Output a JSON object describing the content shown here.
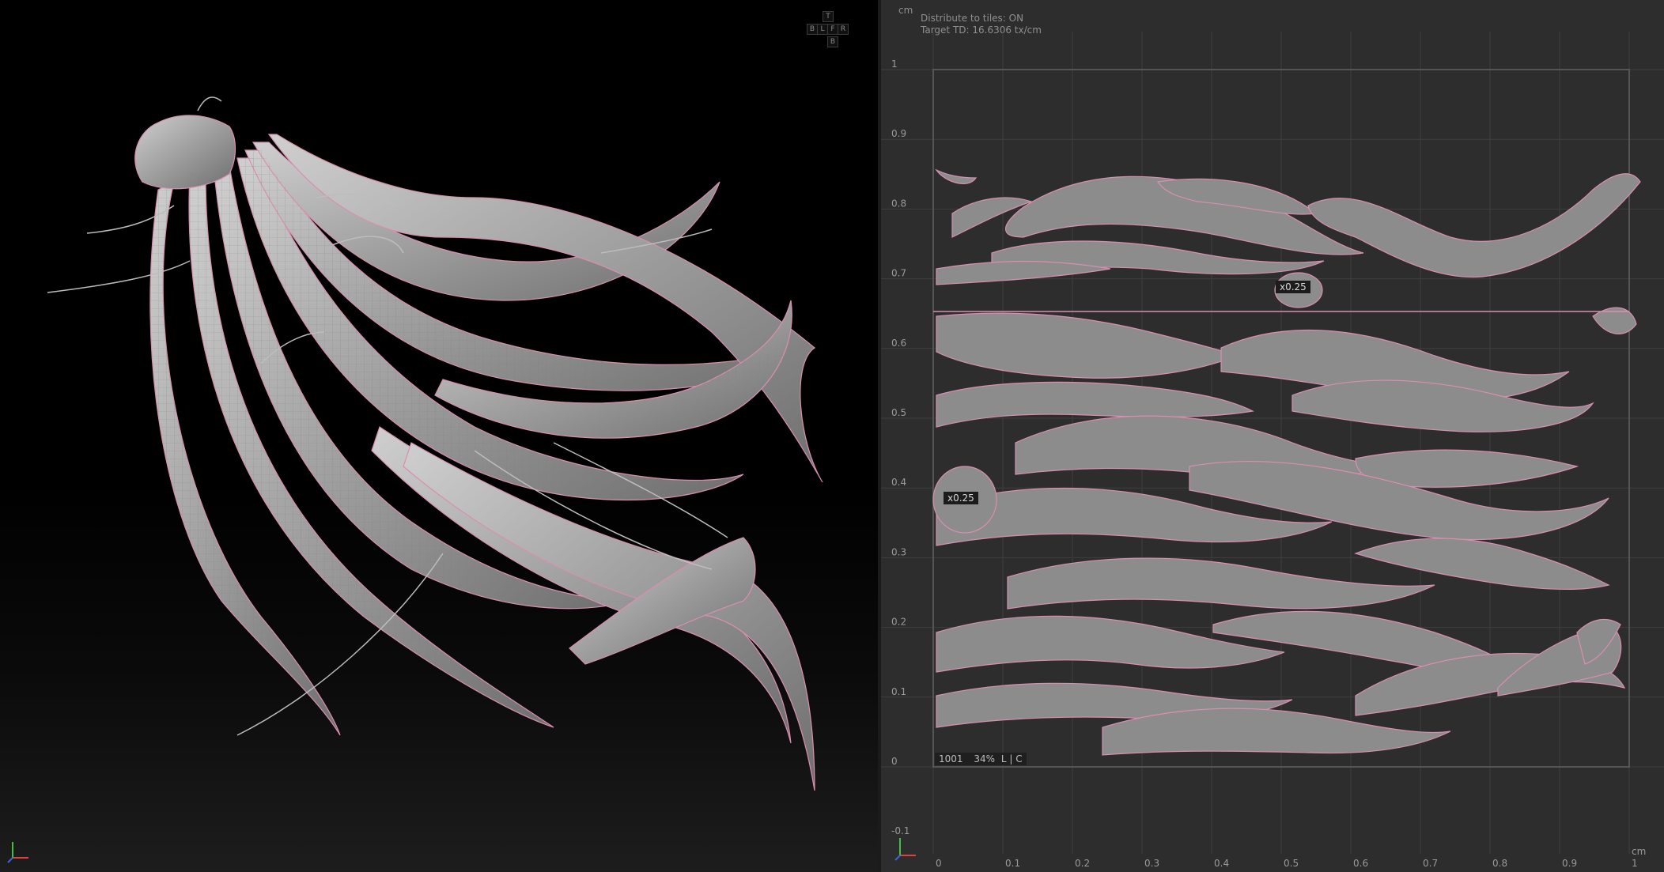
{
  "navcube": {
    "top": "T",
    "back": "B",
    "left": "L",
    "front": "F",
    "right": "R",
    "bottom": "B"
  },
  "uv_info": {
    "unit": "cm",
    "distribute": "Distribute to tiles: ON",
    "target_td": "Target TD: 16.6306 tx/cm"
  },
  "uv_axis": {
    "x_ticks": [
      "0",
      "0.1",
      "0.2",
      "0.3",
      "0.4",
      "0.5",
      "0.6",
      "0.7",
      "0.8",
      "0.9",
      "1"
    ],
    "y_ticks": [
      "1",
      "0.9",
      "0.8",
      "0.7",
      "0.6",
      "0.5",
      "0.4",
      "0.3",
      "0.2",
      "0.1",
      "0",
      "-0.1"
    ],
    "x_unit": "cm"
  },
  "tile_label": {
    "tile": "1001",
    "coverage": "34%",
    "flags": "L | C"
  },
  "badges": {
    "scale_a": "x0.25",
    "scale_b": "x0.25"
  },
  "colors": {
    "mesh": "#8c8c8c",
    "seam": "#d98fb0",
    "uv_bg": "#2d2d2d",
    "grid": "#3e3e3e"
  }
}
